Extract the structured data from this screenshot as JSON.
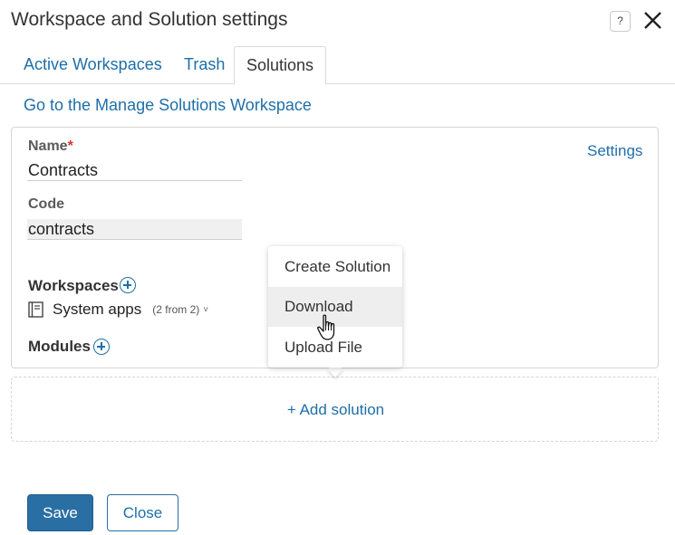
{
  "dialog": {
    "title": "Workspace and Solution settings",
    "help_label": "?"
  },
  "tabs": [
    {
      "label": "Active Workspaces"
    },
    {
      "label": "Trash"
    },
    {
      "label": "Solutions",
      "active": true
    }
  ],
  "manage_link": "Go to the Manage Solutions Workspace",
  "solution_card": {
    "settings_link": "Settings",
    "name_label": "Name",
    "required_mark": "*",
    "name_value": "Contracts",
    "code_label": "Code",
    "code_value": "contracts",
    "workspaces_label": "Workspaces",
    "workspace": {
      "icon": "book-icon",
      "name": "System apps",
      "count": "(2 from 2)",
      "chevron": "˅"
    },
    "modules_label": "Modules"
  },
  "add_solution": "+ Add solution",
  "dropdown_menu": {
    "items": [
      {
        "label": "Create Solution"
      },
      {
        "label": "Download",
        "hovered": true
      },
      {
        "label": "Upload File"
      }
    ]
  },
  "footer": {
    "save_label": "Save",
    "close_label": "Close"
  },
  "colors": {
    "accent": "#1f6fa8",
    "primary_button": "#2a6fa3",
    "required": "#d9342b"
  }
}
